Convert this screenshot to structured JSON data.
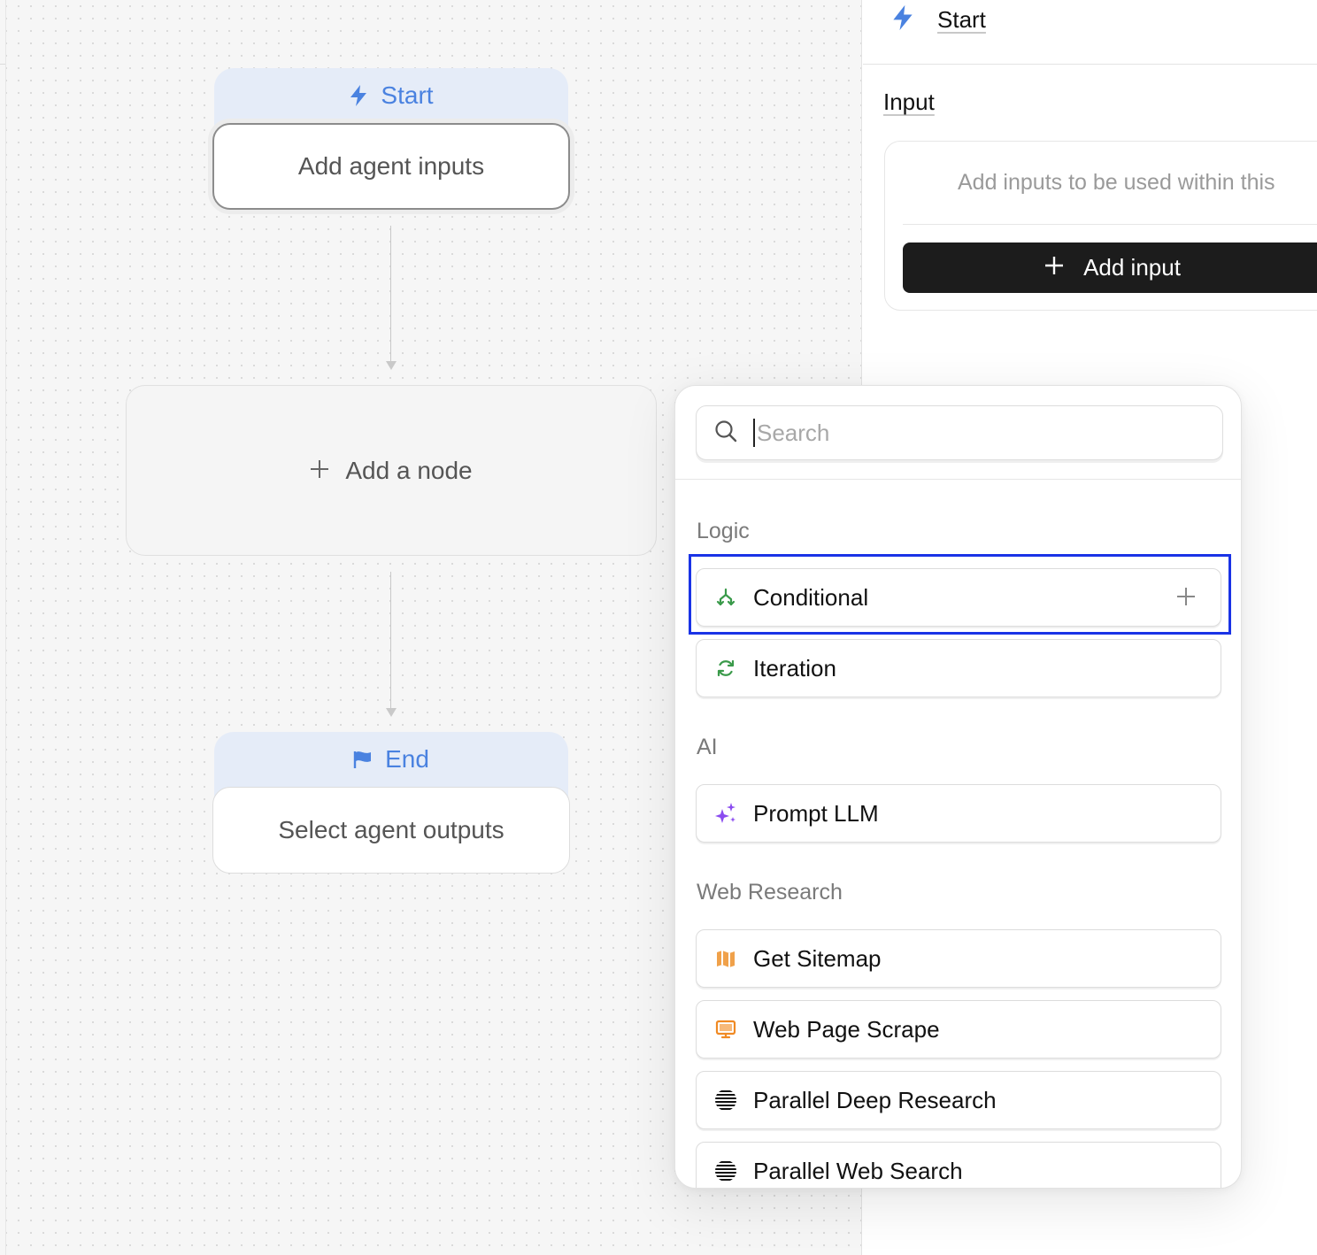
{
  "canvas": {
    "start_node": {
      "title": "Start",
      "body": "Add agent inputs"
    },
    "add_node": {
      "label": "Add a node"
    },
    "end_node": {
      "title": "End",
      "body": "Select agent outputs"
    }
  },
  "panel": {
    "title": "Start",
    "section": "Input",
    "hint": "Add inputs to be used within this",
    "add_input_label": "Add input"
  },
  "node_picker": {
    "search_placeholder": "Search",
    "groups": [
      {
        "label": "Logic",
        "items": [
          {
            "label": "Conditional",
            "icon": "conditional-icon",
            "color": "#3a9a4a"
          },
          {
            "label": "Iteration",
            "icon": "iteration-icon",
            "color": "#3a9a4a"
          }
        ]
      },
      {
        "label": "AI",
        "items": [
          {
            "label": "Prompt LLM",
            "icon": "sparkles-icon",
            "color": "#8b4cf0"
          }
        ]
      },
      {
        "label": "Web Research",
        "items": [
          {
            "label": "Get Sitemap",
            "icon": "map-icon",
            "color": "#f08a24"
          },
          {
            "label": "Web Page Scrape",
            "icon": "monitor-icon",
            "color": "#f08a24"
          },
          {
            "label": "Parallel Deep Research",
            "icon": "parallel-icon",
            "color": "#111111"
          },
          {
            "label": "Parallel Web Search",
            "icon": "parallel-icon",
            "color": "#111111"
          }
        ]
      }
    ]
  },
  "colors": {
    "accent_blue": "#4a82e0",
    "highlight_outline": "#1a33e6",
    "primary_button": "#1c1c1c"
  }
}
